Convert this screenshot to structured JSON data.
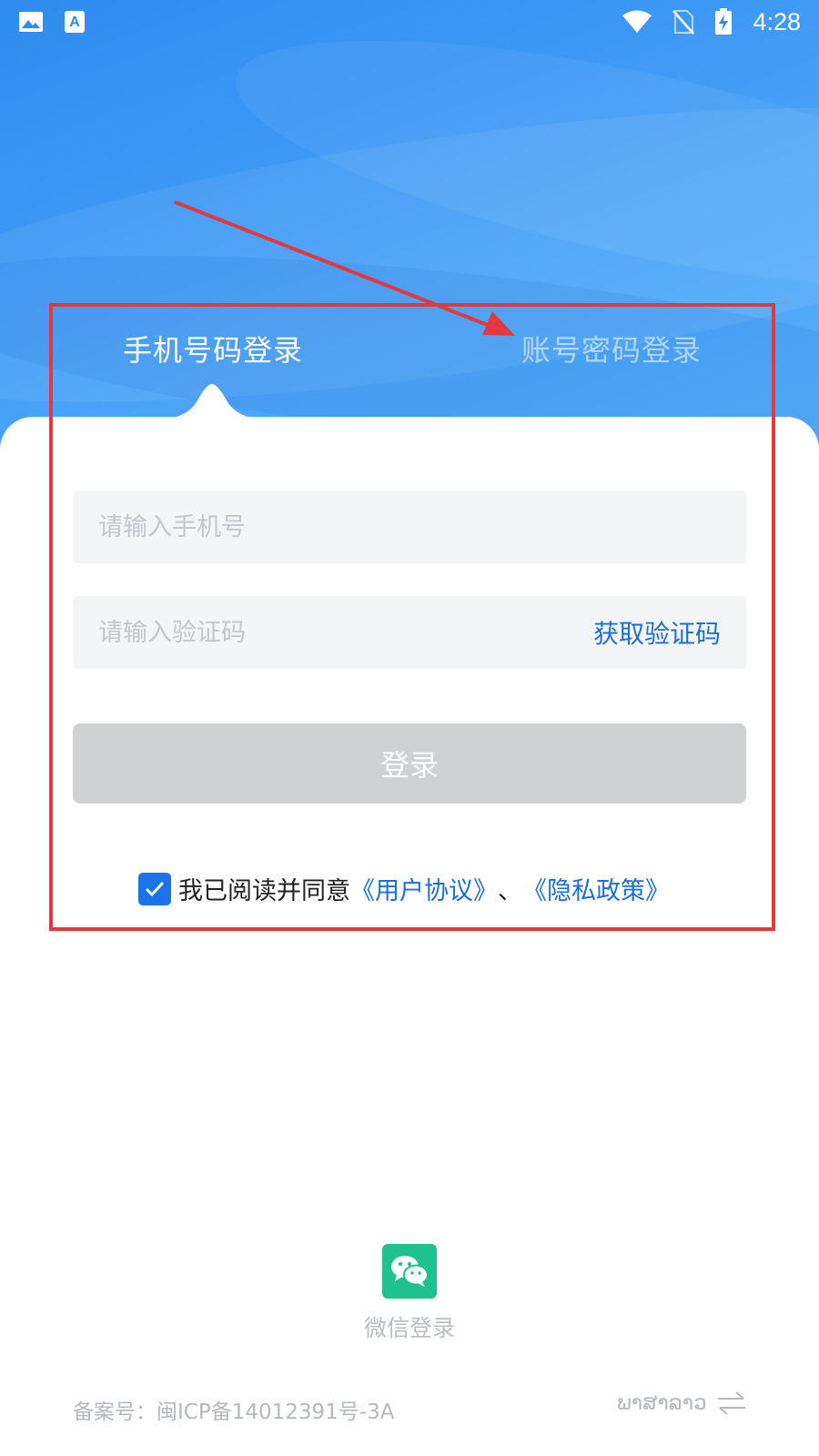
{
  "status_bar": {
    "time": "4:28",
    "left_icons": [
      "image-icon",
      "font-app-icon"
    ],
    "right_icons": [
      "wifi-icon",
      "no-sim-icon",
      "battery-charging-icon"
    ]
  },
  "tabs": [
    {
      "label": "手机号码登录",
      "active": true
    },
    {
      "label": "账号密码登录",
      "active": false
    }
  ],
  "form": {
    "phone_placeholder": "请输入手机号",
    "phone_value": "",
    "code_placeholder": "请输入验证码",
    "code_value": "",
    "get_code_label": "获取验证码",
    "login_label": "登录"
  },
  "agreement": {
    "checked": true,
    "prefix": "我已阅读并同意",
    "user_agreement": "《用户协议》",
    "separator": "、",
    "privacy_policy": "《隐私政策》"
  },
  "wechat": {
    "label": "微信登录"
  },
  "footer": {
    "icp": "备案号：闽ICP备14012391号-3A",
    "language": "ພາສາລາວ"
  },
  "colors": {
    "primary_blue": "#2f8cf0",
    "link_blue": "#1b6fd6",
    "checkbox_blue": "#1c73e8",
    "wechat_green": "#1fc28c",
    "annotation_red": "#e0393f",
    "disabled_button": "#d0d1d3"
  }
}
